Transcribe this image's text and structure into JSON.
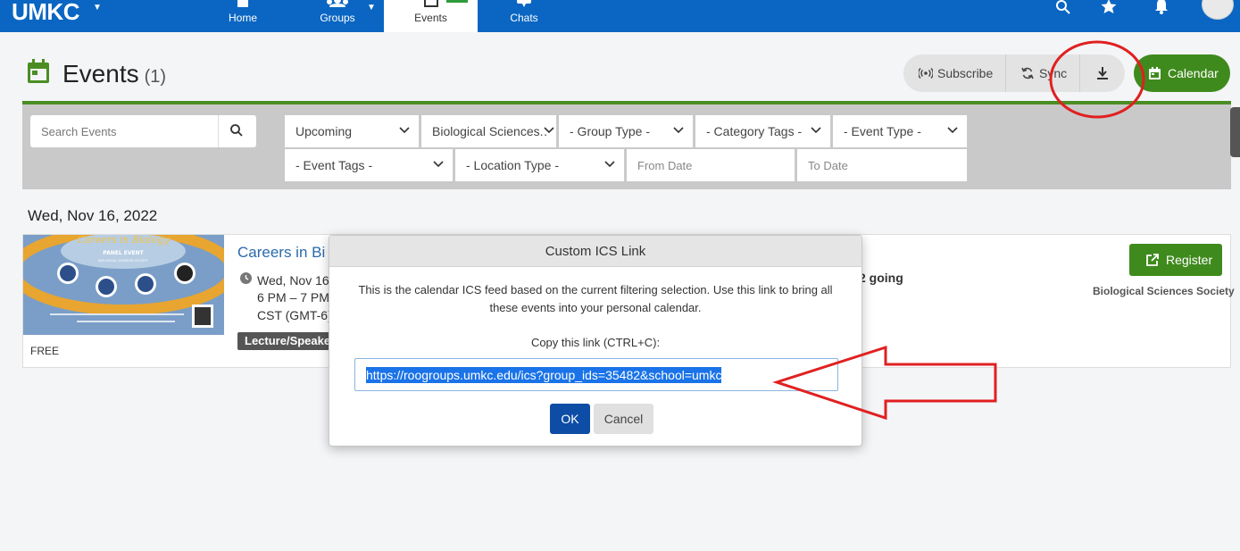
{
  "nav": {
    "brand": "UMKC",
    "items": [
      {
        "label": "Home"
      },
      {
        "label": "Groups"
      },
      {
        "label": "Events"
      },
      {
        "label": "Chats"
      }
    ]
  },
  "header": {
    "title": "Events",
    "count": "(1)",
    "subscribe_label": "Subscribe",
    "sync_label": "Sync",
    "calendar_label": "Calendar"
  },
  "filters": {
    "search_placeholder": "Search Events",
    "row1": [
      "Upcoming",
      "Biological Sciences.…",
      "- Group Type -",
      "- Category Tags -",
      "- Event Type -"
    ],
    "row2": [
      "- Event Tags -",
      "- Location Type -"
    ],
    "from_date_placeholder": "From Date",
    "to_date_placeholder": "To Date"
  },
  "date_heading": "Wed, Nov 16, 2022",
  "event": {
    "title": "Careers in Bi",
    "date": "Wed, Nov 16",
    "time": "6 PM – 7 PM",
    "tz": "CST (GMT-6)",
    "tag": "Lecture/Speake",
    "price": "FREE",
    "going": "2 going",
    "register_label": "Register",
    "org": "Biological Sciences Society",
    "thumb": {
      "headline": "Careers in Biology",
      "sub": "PANEL EVENT",
      "host": "BIOLOGICAL SCIENCES SOCIETY"
    }
  },
  "modal": {
    "title": "Custom ICS Link",
    "text": "This is the calendar ICS feed based on the current filtering selection. Use this link to bring all these events into your personal calendar.",
    "copy_hint": "Copy this link (CTRL+C):",
    "link": "https://roogroups.umkc.edu/ics?group_ids=35482&school=umkc",
    "ok_label": "OK",
    "cancel_label": "Cancel"
  },
  "colors": {
    "nav_blue": "#0a66c2",
    "brand_green": "#3f8a1d",
    "annotation_red": "#e02020",
    "ok_blue": "#0d4da6"
  },
  "icons": [
    "search-icon",
    "star-icon",
    "bell-icon",
    "home-icon",
    "groups-icon",
    "events-icon",
    "chats-icon",
    "calendar-icon",
    "broadcast-icon",
    "sync-icon",
    "download-icon",
    "clock-icon",
    "external-link-icon"
  ]
}
